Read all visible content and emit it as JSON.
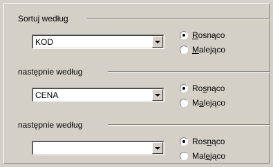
{
  "groups": [
    {
      "label": "Sortuj według",
      "combo_value": "KOD",
      "asc": {
        "before": "",
        "mn": "R",
        "after": "osnąco",
        "checked": true
      },
      "desc": {
        "before": "",
        "mn": "M",
        "after": "alejąco",
        "checked": false
      }
    },
    {
      "label": "następnie według",
      "combo_value": "CENA",
      "asc": {
        "before": "Ro",
        "mn": "s",
        "after": "nąco",
        "checked": true
      },
      "desc": {
        "before": "M",
        "mn": "a",
        "after": "lejąco",
        "checked": false
      }
    },
    {
      "label": "następnie według",
      "combo_value": "",
      "asc": {
        "before": "Ros",
        "mn": "n",
        "after": "ąco",
        "checked": true
      },
      "desc": {
        "before": "Mal",
        "mn": "e",
        "after": "jąco",
        "checked": false
      }
    }
  ]
}
